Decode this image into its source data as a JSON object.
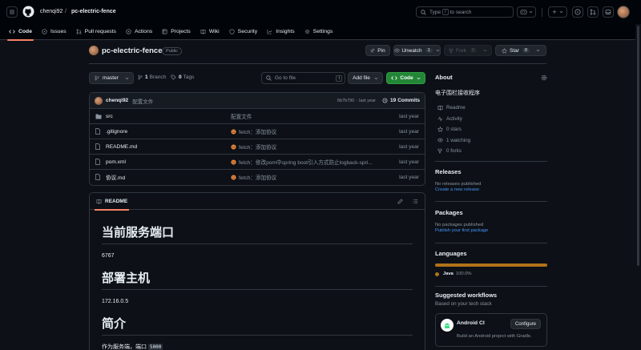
{
  "header": {
    "breadcrumb_owner": "chenqi92",
    "breadcrumb_sep": "/",
    "breadcrumb_repo": "pc-electric-fence",
    "search_prefix": "Type",
    "search_key": "/",
    "search_suffix": "to search",
    "plus_label": "+"
  },
  "tabs": [
    {
      "label": "Code",
      "icon": "code-icon"
    },
    {
      "label": "Issues",
      "icon": "issue-icon"
    },
    {
      "label": "Pull requests",
      "icon": "pull-request-icon"
    },
    {
      "label": "Actions",
      "icon": "play-icon"
    },
    {
      "label": "Projects",
      "icon": "table-icon"
    },
    {
      "label": "Wiki",
      "icon": "book-icon"
    },
    {
      "label": "Security",
      "icon": "shield-icon"
    },
    {
      "label": "Insights",
      "icon": "graph-icon"
    },
    {
      "label": "Settings",
      "icon": "gear-icon"
    }
  ],
  "repo": {
    "name": "pc-electric-fence",
    "visibility": "Public",
    "pin_label": "Pin",
    "unwatch_label": "Unwatch",
    "unwatch_count": "1",
    "fork_label": "Fork",
    "fork_count": "0",
    "star_label": "Star",
    "star_count": "0"
  },
  "toolbar": {
    "branch": "master",
    "branches_count": "1",
    "branches_label": "Branch",
    "tags_count": "0",
    "tags_label": "Tags",
    "goto_placeholder": "Go to file",
    "goto_key": "t",
    "add_file_label": "Add file",
    "code_label": "Code"
  },
  "commit": {
    "author": "chenqi92",
    "message": "配置文件",
    "hash": "6b7b790",
    "time": "last year",
    "commits_count": "19",
    "commits_label": "Commits"
  },
  "files": [
    {
      "name": "src",
      "type": "folder",
      "message": "配置文件",
      "time": "last year",
      "emoji": false
    },
    {
      "name": ".gitignore",
      "type": "file",
      "message": "fetch：添加协议",
      "time": "last year",
      "emoji": true
    },
    {
      "name": "README.md",
      "type": "file",
      "message": "fetch：添加协议",
      "time": "last year",
      "emoji": true
    },
    {
      "name": "pom.xml",
      "type": "file",
      "message": "fetch：修改pom中spring boot引入方式防止logback-spri...",
      "time": "last year",
      "emoji": true
    },
    {
      "name": "协议.md",
      "type": "file",
      "message": "fetch：添加协议",
      "time": "last year",
      "emoji": true
    }
  ],
  "readme": {
    "tab_label": "README",
    "h1_port": "当前服务端口",
    "port": "6767",
    "h1_host": "部署主机",
    "host": "172.16.0.5",
    "h1_intro": "简介",
    "intro_text": "作为服务端，端口",
    "intro_code": "5000"
  },
  "about": {
    "title": "About",
    "description": "电子围栏接收程序",
    "items": [
      {
        "label": "Readme",
        "icon": "book-icon"
      },
      {
        "label": "Activity",
        "icon": "pulse-icon"
      },
      {
        "label": "0 stars",
        "icon": "star-icon"
      },
      {
        "label": "1 watching",
        "icon": "eye-icon"
      },
      {
        "label": "0 forks",
        "icon": "fork-icon"
      }
    ]
  },
  "releases": {
    "title": "Releases",
    "empty": "No releases published",
    "link": "Create a new release"
  },
  "packages": {
    "title": "Packages",
    "empty": "No packages published",
    "link": "Publish your first package"
  },
  "languages": {
    "title": "Languages",
    "items": [
      {
        "name": "Java",
        "percent": "100.0%",
        "color": "#b07219",
        "fraction": 1.0
      }
    ]
  },
  "workflows": {
    "title": "Suggested workflows",
    "subtitle": "Based on your tech stack",
    "card_title": "Android CI",
    "card_desc": "Build an Android project with Gradle.",
    "configure_label": "Configure"
  },
  "colors": {
    "accent_green": "#238636",
    "tab_underline": "#f78166",
    "link": "#4493f8"
  }
}
